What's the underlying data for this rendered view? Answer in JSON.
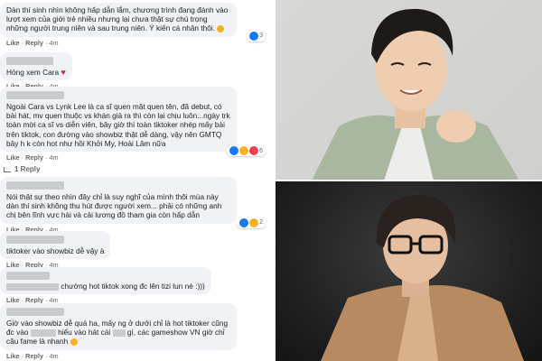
{
  "comments": [
    {
      "text_parts": [
        "Dàn thí sinh nhìn không hấp dẫn lắm, chương trình đang đánh vào lượt xem của giới trẻ nhiều nhưng lại chưa thật sự chú trọng những người trung niên và sau trung niên. Ý kiến cá nhân thôi."
      ],
      "like": "Like",
      "reply": "Reply",
      "time": "4m",
      "reaction_count": "3"
    },
    {
      "text": "Hóng xem Cara",
      "like": "Like",
      "reply": "Reply",
      "time": "4m"
    },
    {
      "text": "Ngoài Cara vs Lynk Lee là ca sĩ quen mặt quen tên, đã debut, có bài hát, mv quen thuộc vs khán giả ra thì còn lại chịu luôn...ngày trk toàn mời ca sĩ vs diễn viên, bây giờ thì toàn tiktoker nhép mấy bài trên tiktok, con đường vào showbiz thật dễ dàng, vậy nên GMTQ bây h k còn hot như hồi Khởi My, Hoài Lâm nữa",
      "like": "Like",
      "reply": "Reply",
      "time": "4m",
      "reaction_count": "6",
      "replies_link": "1 Reply"
    },
    {
      "text": "Nói thật sự theo nhìn đây chỉ là suy nghĩ của mình thôi mùa này dàn thí sinh không thu hút được người xem... phải có những anh chị bên lĩnh vực hài và cải lương đồ tham gia còn hấp dẫn",
      "like": "Like",
      "reply": "Reply",
      "time": "4m",
      "reaction_count": "2"
    },
    {
      "text": "tiktoker vào showbiz dễ vậy à",
      "like": "Like",
      "reply": "Reply",
      "time": "4m"
    },
    {
      "text": "chường hot tiktok xong đc lên tizi lun nè :)))",
      "like": "Like",
      "reply": "Reply",
      "time": "4m"
    },
    {
      "text_a": "Giờ vào showbiz dễ quá ha, mấy ng ở dưới chỉ là hot tiktoker cũng đc vào",
      "text_b": "hiểu vào hát cái",
      "text_c": "gì, các gameshow VN giờ chỉ câu fame là nhanh",
      "like": "Like",
      "reply": "Reply",
      "time": "4m"
    }
  ],
  "colors": {
    "bubble": "#f0f2f5",
    "meta": "#65676b",
    "like_blue": "#1877f2",
    "haha_yellow": "#f7b125",
    "love_red": "#f33e58"
  }
}
